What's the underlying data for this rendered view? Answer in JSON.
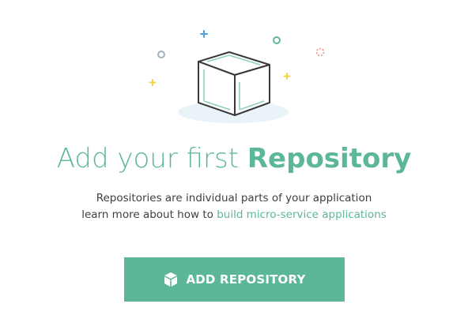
{
  "empty_state": {
    "title_regular": "Add your first ",
    "title_bold": "Repository",
    "description_line1": "Repositories are individual parts of your application",
    "description_line2_prefix": "learn more about how to ",
    "description_link": "build micro-service applications"
  },
  "primary_action": {
    "label": "ADD REPOSITORY",
    "icon": "cube-icon"
  },
  "colors": {
    "accent": "#5cb69a",
    "text": "#3f3f3f",
    "cube_stroke": "#3a3a3a",
    "shadow": "#eaf4f8",
    "sparkle_blue": "#4aa3df",
    "sparkle_yellow": "#f3d34a",
    "sparkle_gray": "#9fb3bf",
    "sparkle_red": "#f08a8a"
  }
}
